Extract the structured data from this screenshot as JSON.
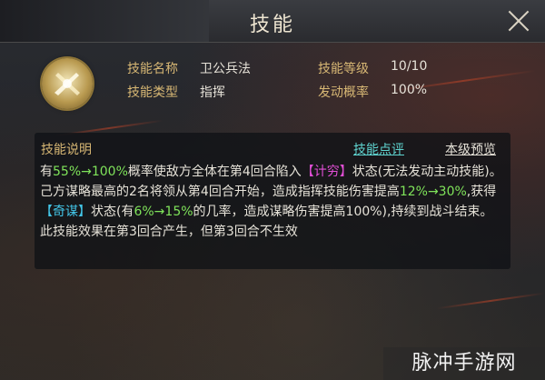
{
  "header": {
    "title": "技能"
  },
  "info": {
    "name_label": "技能名称",
    "name_value": "卫公兵法",
    "level_label": "技能等级",
    "level_value": "10/10",
    "type_label": "技能类型",
    "type_value": "指挥",
    "rate_label": "发动概率",
    "rate_value": "100%"
  },
  "description": {
    "title": "技能说明",
    "review_link": "技能点评",
    "preview_link": "本级预览",
    "segments": [
      "有",
      "55%→100%",
      "概率使敌方全体在第4回合陷入",
      "【计穷】",
      "状态(无法发动主动技能)。己方谋略最高的2名将领从第4回合开始，造成指挥技能伤害提高",
      "12%→30%",
      ",获得",
      "【奇谋】",
      "状态(有",
      "6%→15%",
      "的几率，造成谋略伤害提高100%),持续到战斗结束。此技能效果在第3回合产生，但第3回合不生效"
    ]
  },
  "watermark": "脉冲手游网"
}
